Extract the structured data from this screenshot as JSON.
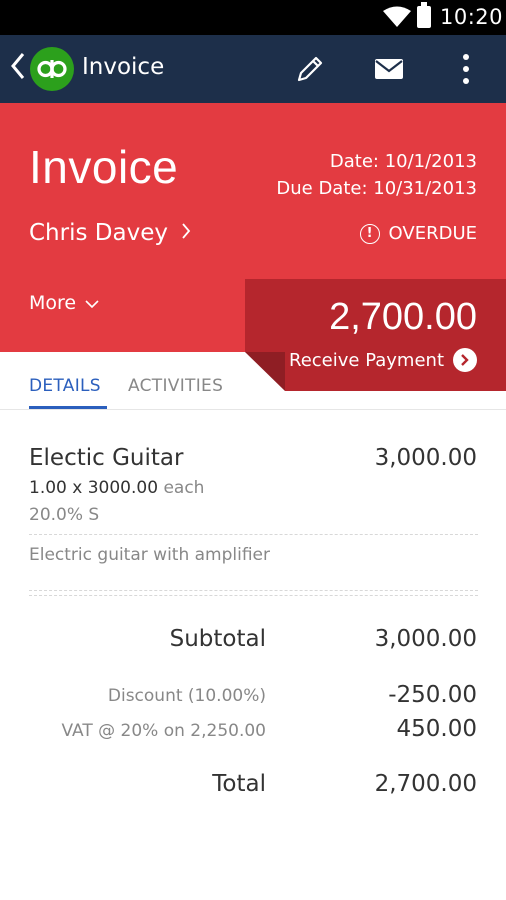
{
  "status_bar": {
    "time": "10:20",
    "icons": [
      "wifi-icon",
      "battery-icon"
    ]
  },
  "action_bar": {
    "title": "Invoice",
    "logo_text": "qb",
    "icons": [
      "back-chevron-icon",
      "pencil-icon",
      "mail-icon",
      "overflow-menu-icon"
    ]
  },
  "header": {
    "doc_type": "Invoice",
    "date": "Date: 10/1/2013",
    "due_date": "Due Date: 10/31/2013",
    "customer": "Chris Davey",
    "status": "OVERDUE",
    "more_label": "More"
  },
  "payment": {
    "amount": "2,700.00",
    "action_label": "Receive Payment"
  },
  "tabs": [
    {
      "label": "DETAILS",
      "active": true
    },
    {
      "label": "ACTIVITIES",
      "active": false
    }
  ],
  "line_items": [
    {
      "name": "Electic Guitar",
      "amount": "3,000.00",
      "quantity": "1.00 x 3000.00",
      "unit": "each",
      "tax": "20.0% S",
      "description": "Electric guitar with amplifier"
    }
  ],
  "totals": {
    "subtotal_label": "Subtotal",
    "subtotal": "3,000.00",
    "discount_label": "Discount (10.00%)",
    "discount": "-250.00",
    "vat_label": "VAT @ 20% on 2,250.00",
    "vat": "450.00",
    "total_label": "Total",
    "total": "2,700.00"
  },
  "colors": {
    "header_red": "#e33b41",
    "payment_red": "#b5262d",
    "action_bar_navy": "#1d2f4a",
    "brand_green": "#2ca01c",
    "tab_blue": "#2b5fbd"
  }
}
